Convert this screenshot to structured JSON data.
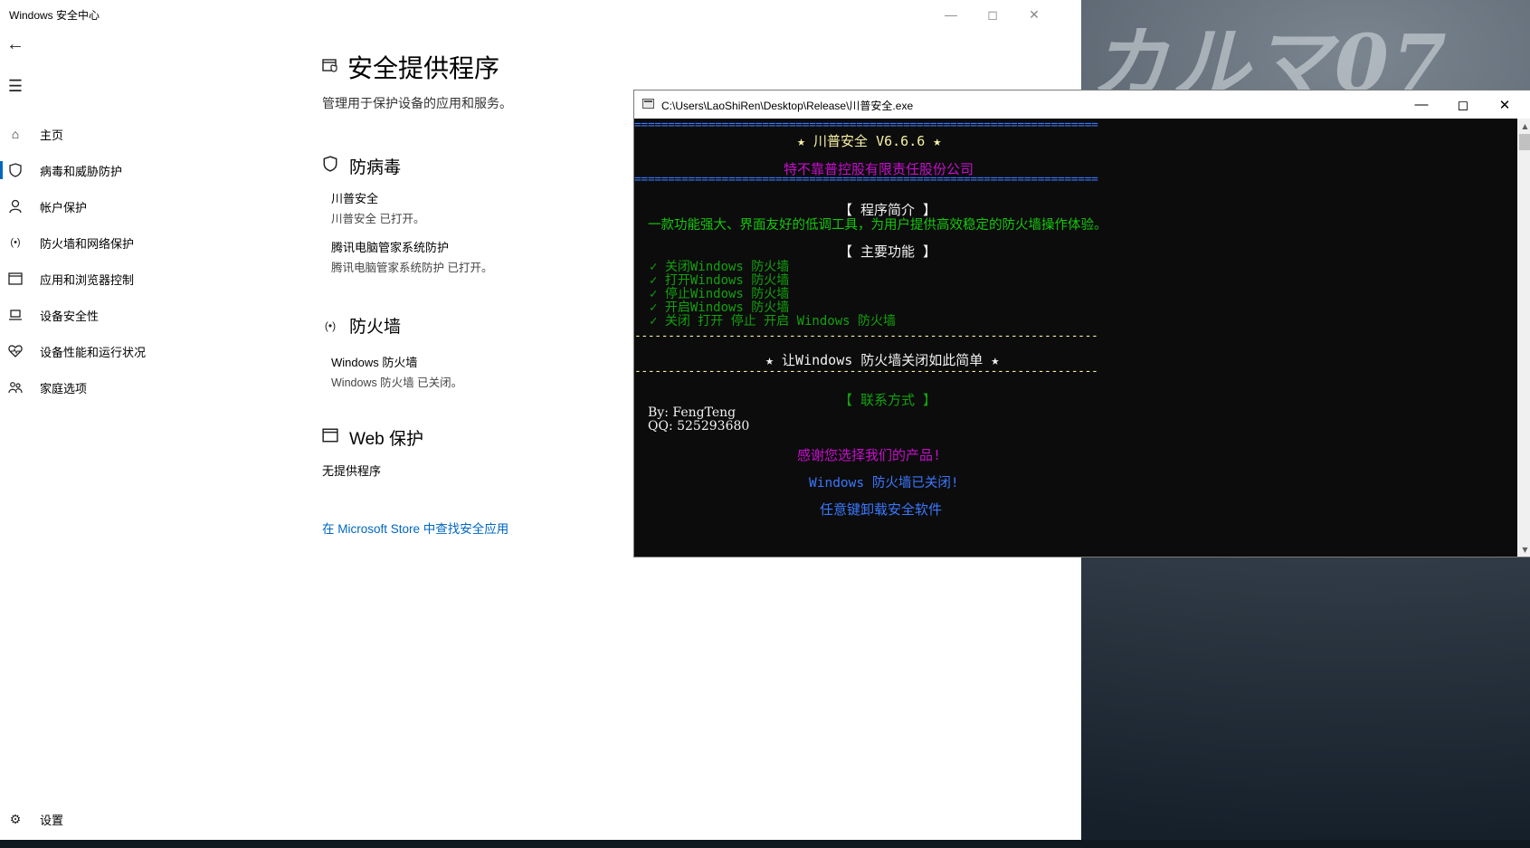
{
  "desktop": {
    "wallpaper_text": "カルマ07"
  },
  "security_app": {
    "window_title": "Windows 安全中心",
    "nav": [
      {
        "label": "主页",
        "icon": "home-icon"
      },
      {
        "label": "病毒和威胁防护",
        "icon": "shield-icon",
        "active": true
      },
      {
        "label": "帐户保护",
        "icon": "person-icon"
      },
      {
        "label": "防火墙和网络保护",
        "icon": "antenna-icon"
      },
      {
        "label": "应用和浏览器控制",
        "icon": "browser-window-icon"
      },
      {
        "label": "设备安全性",
        "icon": "laptop-icon"
      },
      {
        "label": "设备性能和运行状况",
        "icon": "heart-pulse-icon"
      },
      {
        "label": "家庭选项",
        "icon": "family-icon"
      }
    ],
    "settings_label": "设置",
    "page_title": "安全提供程序",
    "page_subtitle": "管理用于保护设备的应用和服务。",
    "antivirus": {
      "heading": "防病毒",
      "providers": [
        {
          "name": "川普安全",
          "status": "川普安全 已打开。"
        },
        {
          "name": "腾讯电脑管家系统防护",
          "status": "腾讯电脑管家系统防护 已打开。"
        }
      ]
    },
    "firewall": {
      "heading": "防火墙",
      "providers": [
        {
          "name": "Windows 防火墙",
          "status": "Windows 防火墙 已关闭。"
        }
      ]
    },
    "web_protection": {
      "heading": "Web 保护",
      "no_provider": "无提供程序"
    },
    "store_link": "在 Microsoft Store 中查找安全应用"
  },
  "console": {
    "title": "C:\\Users\\LaoShiRen\\Desktop\\Release\\川普安全.exe",
    "lines": {
      "sep_eq": "=====================================================================",
      "app_title": "★ 川普安全 V6.6.6 ★",
      "company": "特不靠普控股有限责任股份公司",
      "intro_heading": "【 程序简介 】",
      "intro_text": "一款功能强大、界面友好的低调工具，为用户提供高效稳定的防火墙操作体验。",
      "features_heading": "【 主要功能 】",
      "features": [
        "✓ 关闭Windows 防火墙",
        "✓ 打开Windows 防火墙",
        "✓ 停止Windows 防火墙",
        "✓ 开启Windows 防火墙",
        "✓ 关闭 打开 停止 开启 Windows 防火墙"
      ],
      "sep_dash": "---------------------------------------------------------------------",
      "slogan": "★ 让Windows 防火墙关闭如此简单 ★",
      "contact_heading": "【 联系方式 】",
      "by": "By: FengTeng",
      "qq": "QQ: 525293680",
      "thanks": "感谢您选择我们的产品!",
      "status": "Windows 防火墙已关闭!",
      "prompt": "任意键卸载安全软件"
    }
  }
}
